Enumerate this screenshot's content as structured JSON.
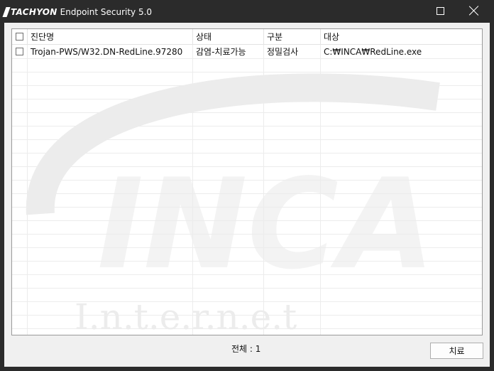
{
  "window": {
    "brand": "TACHYON",
    "title": "Endpoint Security 5.0"
  },
  "table": {
    "columns": [
      "진단명",
      "상태",
      "구분",
      "대상"
    ],
    "rows": [
      {
        "name": "Trojan-PWS/W32.DN-RedLine.97280",
        "status": "감염-치료가능",
        "category": "정밀검사",
        "target": "C:₩INCA₩RedLine.exe"
      }
    ]
  },
  "watermark": {
    "logo": "INCA",
    "sub": "I.n.t.e.r.n.e.t"
  },
  "footer": {
    "total": "전체 : 1",
    "treat_button": "치료"
  }
}
